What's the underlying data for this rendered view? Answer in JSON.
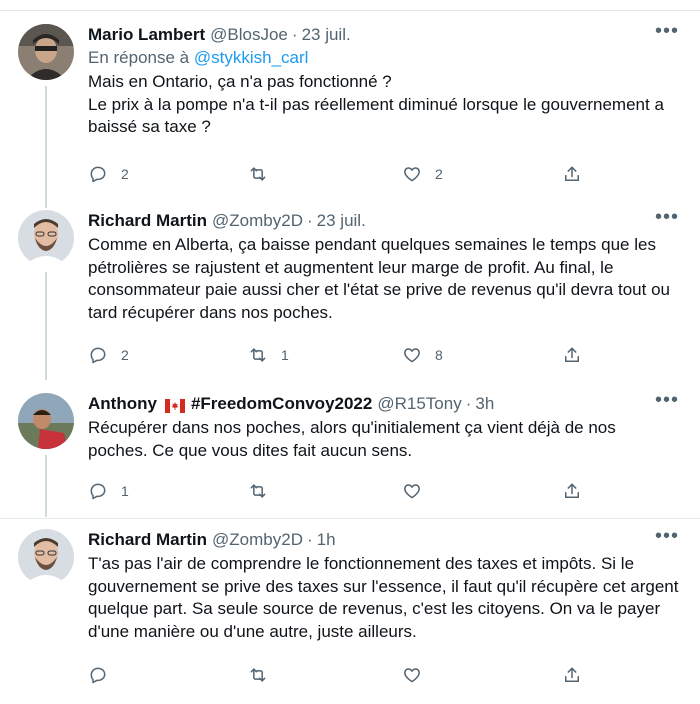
{
  "tweets": [
    {
      "name": "Mario Lambert",
      "handle": "@BlosJoe",
      "time": "23 juil.",
      "reply_prefix": "En réponse à",
      "reply_to": "@stykkish_carl",
      "lines": [
        "Mais en Ontario, ça n'a pas fonctionné ?",
        "Le prix à la pompe n'a t-il pas réellement diminué lorsque le gouvernement a baissé sa taxe ?"
      ],
      "replies": "2",
      "retweets": "",
      "likes": "2"
    },
    {
      "name": "Richard Martin",
      "handle": "@Zomby2D",
      "time": "23 juil.",
      "lines": [
        "Comme en Alberta, ça baisse pendant quelques semaines le temps que les pétrolières se rajustent et augmentent leur marge de profit. Au final, le consommateur paie aussi cher et l'état se prive de revenus qu'il devra tout ou tard récupérer dans nos poches."
      ],
      "replies": "2",
      "retweets": "1",
      "likes": "8"
    },
    {
      "name_prefix": "Anthony",
      "name_suffix": "#FreedomConvoy2022",
      "handle": "@R15Tony",
      "time": "3h",
      "lines": [
        "Récupérer dans nos poches, alors qu'initialement ça vient déjà de nos poches. Ce que vous dites fait aucun sens."
      ],
      "replies": "1",
      "retweets": "",
      "likes": ""
    },
    {
      "name": "Richard Martin",
      "handle": "@Zomby2D",
      "time": "1h",
      "lines": [
        "T'as pas l'air de comprendre le fonctionnement des taxes et impôts. Si le gouvernement se prive des taxes sur l'essence, il faut qu'il récupère cet argent quelque part. Sa seule source de revenus, c'est les citoyens. On va le payer d'une manière ou d'une autre, juste ailleurs."
      ],
      "replies": "",
      "retweets": "",
      "likes": ""
    }
  ],
  "separator": "·",
  "more_glyph": "•••",
  "colors": {
    "accent": "#1d9bf0",
    "secondary": "#536471",
    "text": "#0f1419",
    "thread": "#cfd9de"
  },
  "icons": [
    "reply-icon",
    "retweet-icon",
    "like-icon",
    "share-icon",
    "more-icon",
    "canada-flag-icon"
  ]
}
